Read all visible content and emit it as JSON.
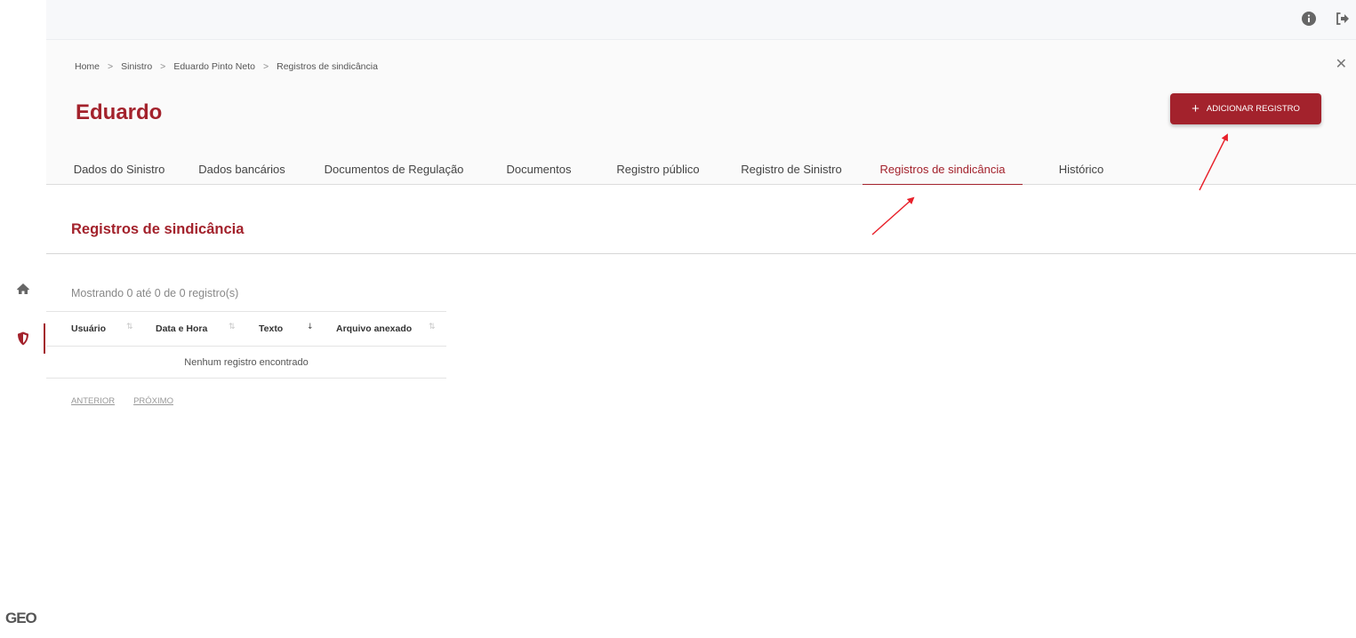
{
  "sidebar": {
    "items": [
      {
        "name": "home",
        "icon": "home-icon"
      },
      {
        "name": "sinistro",
        "icon": "shield-icon",
        "active": true
      }
    ],
    "logo": "GEO"
  },
  "topbar": {
    "icons": [
      "info-icon",
      "logout-icon"
    ]
  },
  "header": {
    "breadcrumb": [
      "Home",
      "Sinistro",
      "Eduardo Pinto Neto",
      "Registros de sindicância"
    ],
    "breadcrumb_separator": ">",
    "title": "Eduardo",
    "add_button_label": "ADICIONAR REGISTRO",
    "add_button_icon": "plus-icon",
    "close_icon": "close-icon"
  },
  "tabs": [
    {
      "label": "Dados do Sinistro"
    },
    {
      "label": "Dados bancários"
    },
    {
      "label": "Documentos de Regulação"
    },
    {
      "label": "Documentos"
    },
    {
      "label": "Registro público"
    },
    {
      "label": "Registro de Sinistro"
    },
    {
      "label": "Registros de sindicância",
      "active": true
    },
    {
      "label": "Histórico"
    }
  ],
  "section": {
    "title": "Registros de sindicância",
    "showing": "Mostrando 0 até 0 de 0 registro(s)",
    "columns": [
      {
        "label": "Usuário",
        "sort": "⇅"
      },
      {
        "label": "Data e Hora",
        "sort": "⇅"
      },
      {
        "label": "Texto",
        "sort": "↓"
      },
      {
        "label": "Arquivo anexado",
        "sort": "⇅"
      }
    ],
    "empty_message": "Nenhum registro encontrado",
    "pager": {
      "previous": "ANTERIOR",
      "next": "PRÓXIMO"
    }
  },
  "colors": {
    "brand": "#a3222c",
    "annotation_arrow": "#e8202a"
  }
}
